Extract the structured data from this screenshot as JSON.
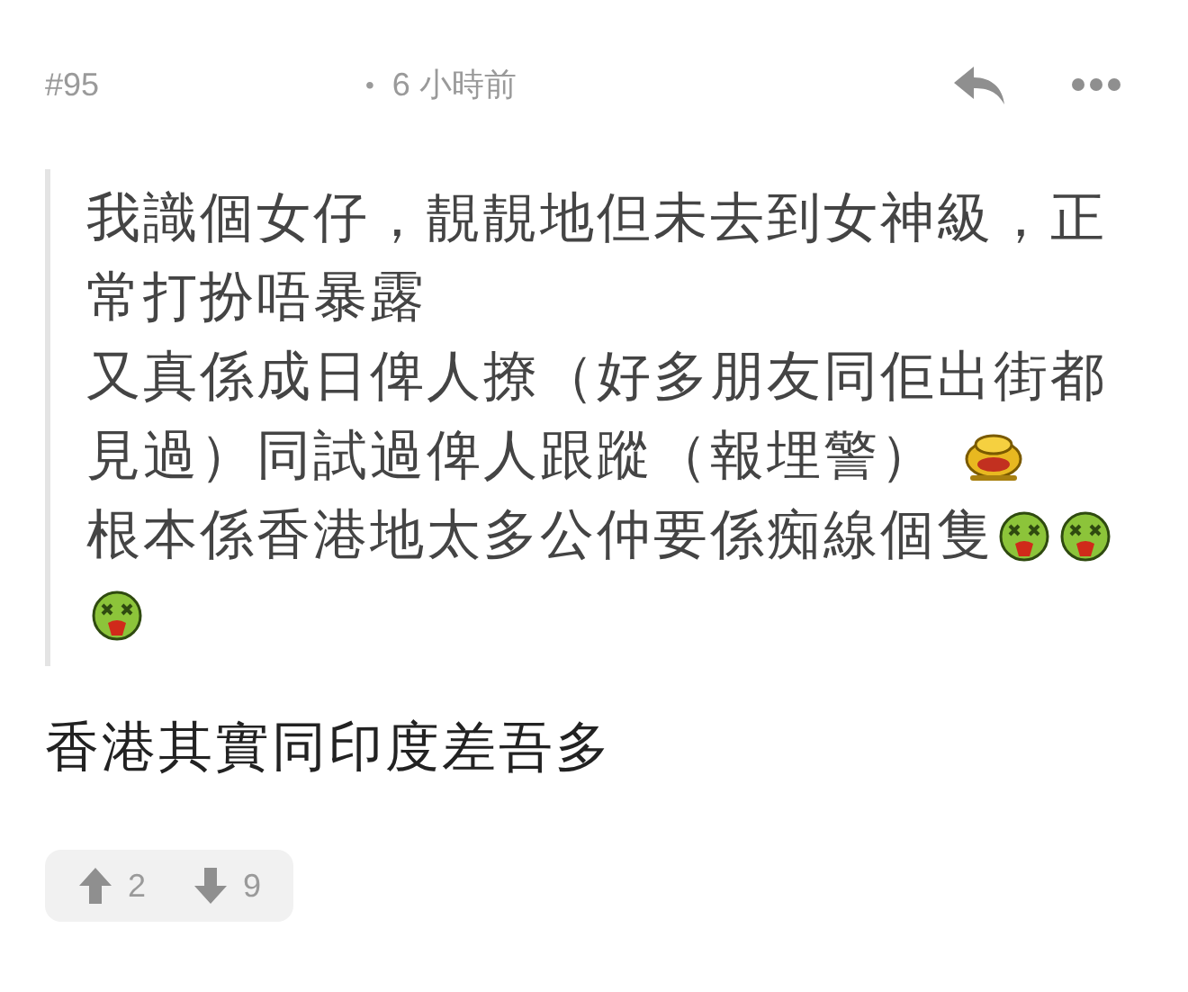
{
  "header": {
    "floor": "#95",
    "bullet": "•",
    "time": "6 小時前"
  },
  "quote": {
    "paragraphs": [
      {
        "parts": [
          {
            "kind": "text",
            "text": "我識個女仔，靚靚地但未去到女神級，正常打扮唔暴露"
          }
        ]
      },
      {
        "parts": [
          {
            "kind": "text",
            "text": "又真係成日俾人撩（好多朋友同佢出街都見過）同試過俾人跟蹤（報埋警）"
          },
          {
            "kind": "frog"
          }
        ]
      },
      {
        "parts": [
          {
            "kind": "text",
            "text": "根本係香港地太多公仲要係痴線個隻"
          },
          {
            "kind": "sick"
          },
          {
            "kind": "sick"
          },
          {
            "kind": "sick"
          }
        ]
      }
    ]
  },
  "body": "香港其實同印度差吾多",
  "votes": {
    "up": "2",
    "down": "9"
  }
}
